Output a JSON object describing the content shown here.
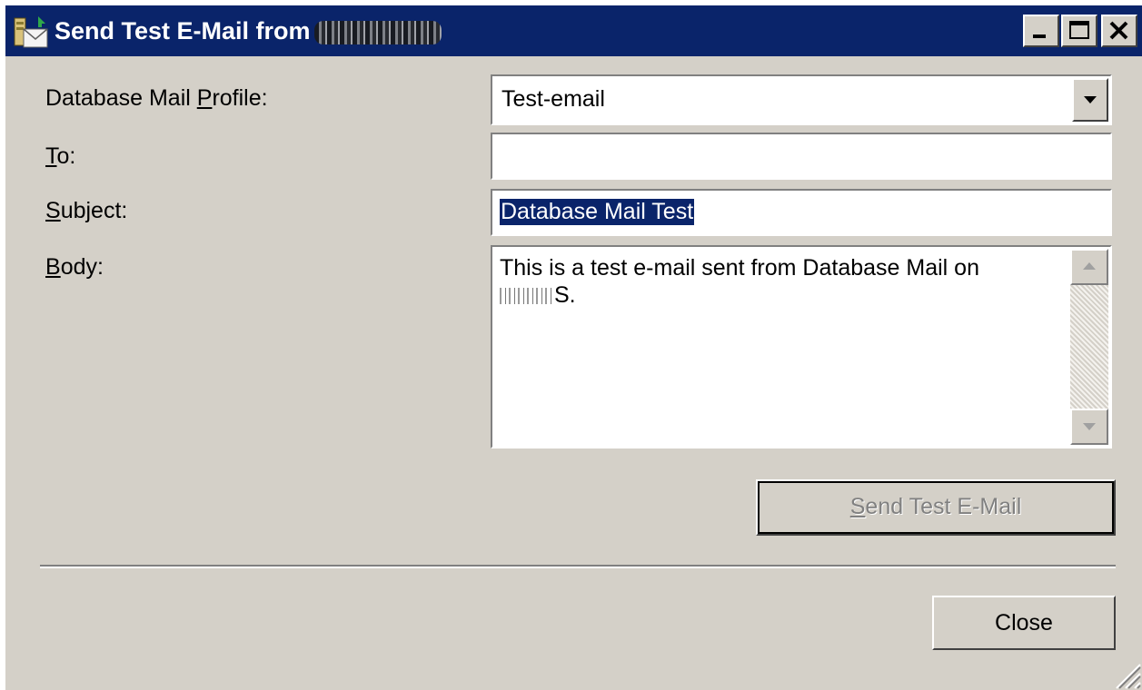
{
  "window": {
    "title": "Send Test E-Mail from",
    "title_icon": "mail-server-icon",
    "buttons": {
      "minimize": "minimize-icon",
      "maximize": "maximize-icon",
      "close": "close-icon"
    }
  },
  "form": {
    "profile_label_pre": "Database Mail ",
    "profile_label_key": "P",
    "profile_label_post": "rofile:",
    "profile_value": "Test-email",
    "to_label_key": "T",
    "to_label_post": "o:",
    "to_value": "",
    "subject_label_key": "S",
    "subject_label_post": "ubject:",
    "subject_value": "Database Mail Test",
    "body_label_key": "B",
    "body_label_post": "ody:",
    "body_value_line1": "This is a test e-mail sent from Database Mail on",
    "body_value_line2_suffix": "S."
  },
  "buttons": {
    "send_key": "S",
    "send_post": "end Test E-Mail",
    "close": "Close"
  },
  "colors": {
    "titlebar": "#0a246a",
    "dialog_bg": "#d4d0c8",
    "selection_bg": "#0a246a"
  }
}
